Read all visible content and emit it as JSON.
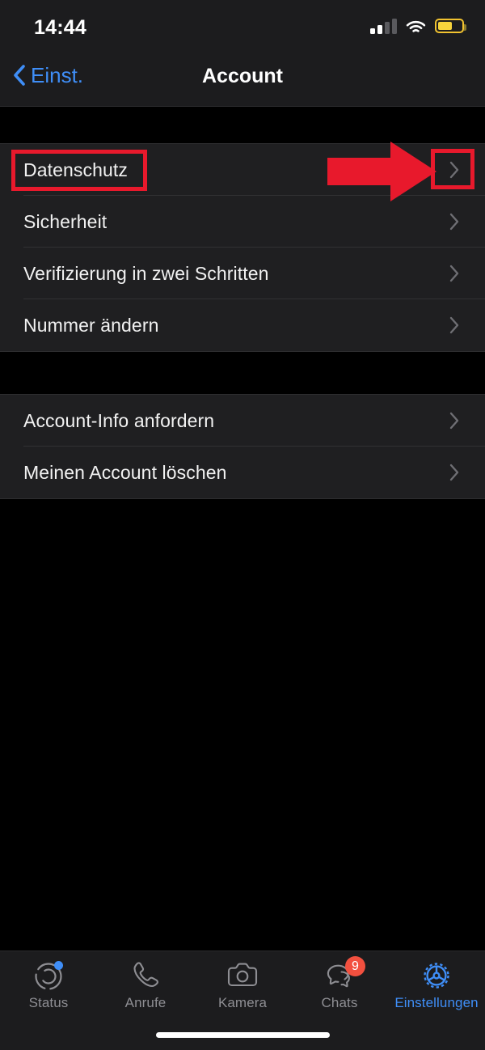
{
  "statusbar": {
    "time": "14:44",
    "signal_icon": "cellular-signal-icon",
    "signal_bars_filled": 2,
    "signal_bars_total": 4,
    "wifi_icon": "wifi-icon",
    "battery_icon": "battery-icon",
    "battery_color": "#f6d33c",
    "battery_level_percent": 52
  },
  "navbar": {
    "back_icon": "chevron-left-icon",
    "back_label": "Einst.",
    "title": "Account",
    "accent_color": "#3f8ef7"
  },
  "list": {
    "groups": [
      {
        "rows": [
          {
            "label": "Datenschutz",
            "chevron_icon": "chevron-right-icon"
          },
          {
            "label": "Sicherheit",
            "chevron_icon": "chevron-right-icon"
          },
          {
            "label": "Verifizierung in zwei Schritten",
            "chevron_icon": "chevron-right-icon"
          },
          {
            "label": "Nummer ändern",
            "chevron_icon": "chevron-right-icon"
          }
        ]
      },
      {
        "rows": [
          {
            "label": "Account-Info anfordern",
            "chevron_icon": "chevron-right-icon"
          },
          {
            "label": "Meinen Account löschen",
            "chevron_icon": "chevron-right-icon"
          }
        ]
      }
    ]
  },
  "annotations": {
    "color": "#e8192c",
    "arrow_icon": "right-arrow-annotation",
    "label_highlight_target": "Datenschutz",
    "chevron_highlight_target": "chevron-right-icon"
  },
  "tabbar": {
    "items": [
      {
        "label": "Status",
        "icon": "status-rings-icon",
        "active": false,
        "dot": true,
        "badge": ""
      },
      {
        "label": "Anrufe",
        "icon": "phone-icon",
        "active": false,
        "dot": false,
        "badge": ""
      },
      {
        "label": "Kamera",
        "icon": "camera-icon",
        "active": false,
        "dot": false,
        "badge": ""
      },
      {
        "label": "Chats",
        "icon": "chat-bubbles-icon",
        "active": false,
        "dot": false,
        "badge": "9"
      },
      {
        "label": "Einstellungen",
        "icon": "gear-icon",
        "active": true,
        "dot": false,
        "badge": ""
      }
    ],
    "active_color": "#3f8ef7",
    "inactive_color": "#8e8e93",
    "badge_color": "#f2503f"
  },
  "home_indicator": "home-indicator"
}
